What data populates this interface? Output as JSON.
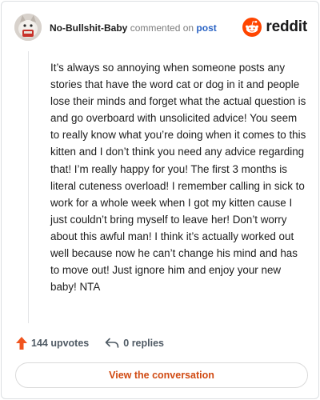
{
  "comment": {
    "username": "No-Bullshit-Baby",
    "action_text": "commented on",
    "post_link_label": "post",
    "body": "It’s always so annoying when someone posts any stories that have the word cat or dog in it and people lose their minds and forget what the actual question is and go overboard with unsolicited advice! You seem to really know what you’re doing when it comes to this kitten and I don’t think you need any advice regarding that! I’m really happy for you! The first 3 months is literal cuteness overload! I remember calling in sick to work for a whole week when I got my kitten cause I just couldn’t bring myself to leave her! Don’t worry about this awful man! I think it’s actually worked out well because now he can’t change his mind and has to move out! Just ignore him and enjoy your new baby! NTA"
  },
  "brand": {
    "wordmark": "reddit",
    "logo_icon": "reddit-logo-icon",
    "color": "#ff4500"
  },
  "stats": {
    "upvotes_label": "144 upvotes",
    "upvote_icon": "upvote-arrow-icon",
    "upvote_color": "#f0541e",
    "replies_label": "0 replies",
    "reply_icon": "reply-arrow-icon"
  },
  "cta": {
    "label": "View the conversation",
    "color": "#d04a12"
  },
  "colors": {
    "username": "#1c1c1c",
    "link": "#2a63c4",
    "muted": "#7c7c7c"
  }
}
